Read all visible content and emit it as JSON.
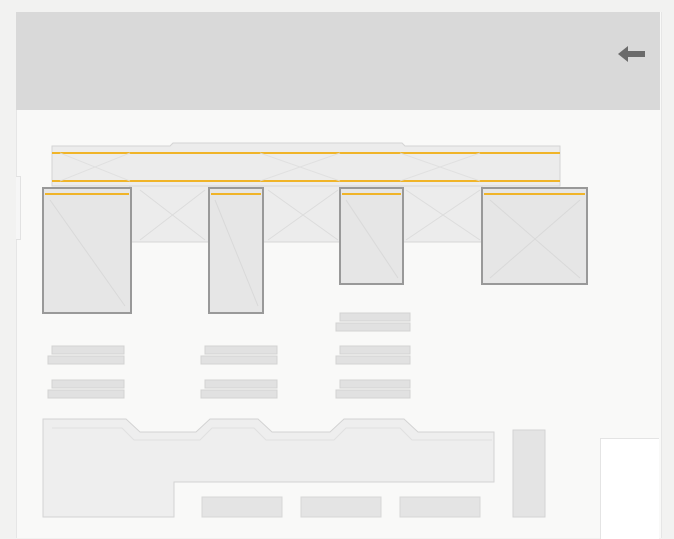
{
  "header": {
    "back_icon": "arrow-left-icon",
    "back_icon_color": "#6b6b6b"
  },
  "colors": {
    "header_bg": "#d9d9d9",
    "panel_bg": "#f9f9f8",
    "room_fill": "#e6e6e6",
    "room_border": "#999999",
    "accent_line": "#f0b429",
    "furniture": "#e1e1e1"
  }
}
